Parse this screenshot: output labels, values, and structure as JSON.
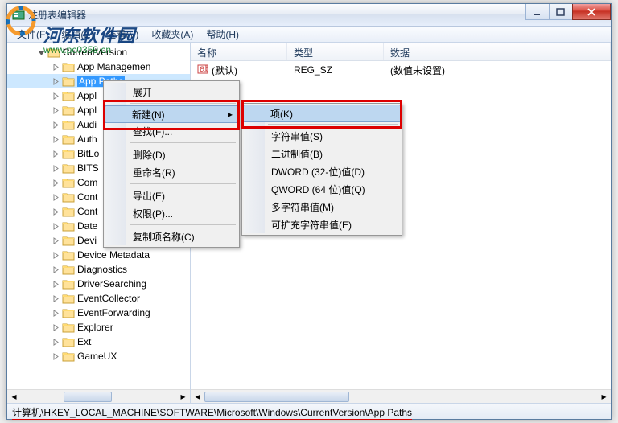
{
  "window": {
    "title": "注册表编辑器"
  },
  "menu": {
    "file": "文件(F)",
    "edit": "编辑(E)",
    "view": "查看(V)",
    "favorites": "收藏夹(A)",
    "help": "帮助(H)"
  },
  "tree": {
    "root": "CurrentVersion",
    "items": [
      "App Managemen",
      "App Paths",
      "Appl",
      "Appl",
      "Audi",
      "Auth",
      "BitLo",
      "BITS",
      "Com",
      "Cont",
      "Cont",
      "Date",
      "Devi",
      "Device Metadata",
      "Diagnostics",
      "DriverSearching",
      "EventCollector",
      "EventForwarding",
      "Explorer",
      "Ext",
      "GameUX"
    ],
    "selected_index": 1
  },
  "columns": {
    "name": "名称",
    "type": "类型",
    "data": "数据"
  },
  "list": {
    "rows": [
      {
        "name": "(默认)",
        "type": "REG_SZ",
        "data": "(数值未设置)"
      }
    ]
  },
  "context1": {
    "expand": "展开",
    "new": "新建(N)",
    "find": "查找(F)...",
    "delete": "删除(D)",
    "rename": "重命名(R)",
    "export": "导出(E)",
    "permissions": "权限(P)...",
    "copykey": "复制项名称(C)"
  },
  "context2": {
    "key": "项(K)",
    "string": "字符串值(S)",
    "binary": "二进制值(B)",
    "dword": "DWORD (32-位)值(D)",
    "qword": "QWORD (64 位)值(Q)",
    "multi": "多字符串值(M)",
    "expand": "可扩充字符串值(E)"
  },
  "statusbar": {
    "path": "计算机\\HKEY_LOCAL_MACHINE\\SOFTWARE\\Microsoft\\Windows\\CurrentVersion\\App Paths"
  },
  "watermark": {
    "text": "河东软件园",
    "url": "www.pc0359.cn"
  }
}
